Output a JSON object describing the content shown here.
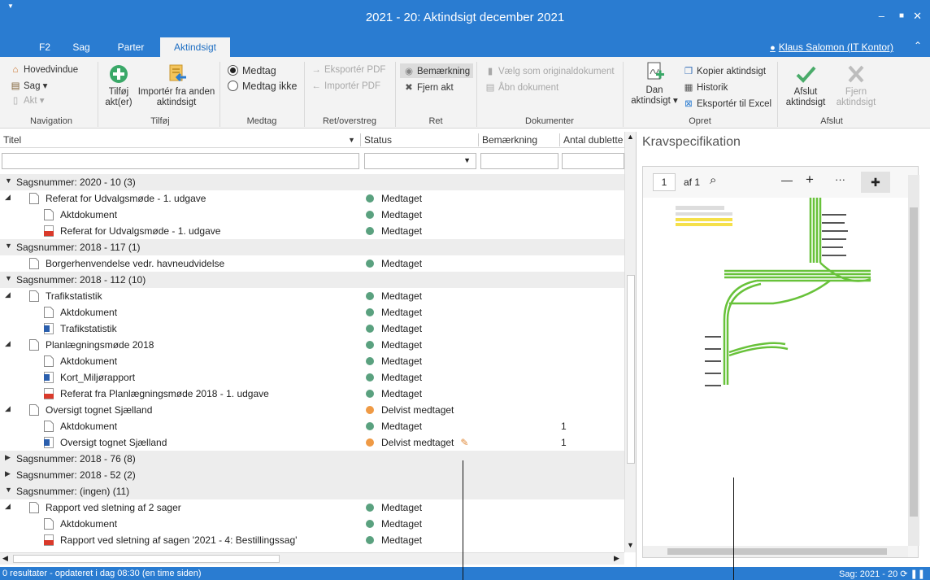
{
  "window": {
    "title": "2021 - 20: Aktindsigt december 2021",
    "minimize": "‒",
    "maximize": "■",
    "close": "✕"
  },
  "tabs": [
    "F2",
    "Sag",
    "Parter",
    "Aktindsigt"
  ],
  "user": "Klaus Salomon (IT Kontor)",
  "ribbon": {
    "navigation": {
      "hovedvindue": "Hovedvindue",
      "sag": "Sag ▾",
      "akt": "Akt ▾",
      "label": "Navigation"
    },
    "tilfoj": {
      "tilfoj_akt": "Tilføj akt(er)",
      "importer": "Importér fra anden aktindsigt",
      "label": "Tilføj"
    },
    "medtag": {
      "medtag": "Medtag",
      "medtag_ikke": "Medtag ikke",
      "label": "Medtag"
    },
    "ret_overstreg": {
      "eksporter_pdf": "Eksportér PDF",
      "importer_pdf": "Importér PDF",
      "label": "Ret/overstreg"
    },
    "ret": {
      "bemaerkning": "Bemærkning",
      "fjern_akt": "Fjern akt",
      "label": "Ret"
    },
    "dokumenter": {
      "vaelg": "Vælg som originaldokument",
      "abn": "Åbn dokument",
      "label": "Dokumenter"
    },
    "opret": {
      "dan": "Dan aktindsigt ▾",
      "kopier": "Kopier aktindsigt",
      "historik": "Historik",
      "excel": "Eksportér til Excel",
      "label": "Opret"
    },
    "afslut": {
      "afslut": "Afslut aktindsigt",
      "fjern": "Fjern aktindsigt",
      "label": "Afslut"
    }
  },
  "columns": {
    "titel": "Titel",
    "status": "Status",
    "bemaerkning": "Bemærkning",
    "antal": "Antal dublette"
  },
  "status_colors": {
    "Medtaget": "#5aa17f",
    "Delvist medtaget": "#ef9a45"
  },
  "rows": [
    {
      "type": "group",
      "open": true,
      "text": "Sagsnummer: 2020 - 10 (3)"
    },
    {
      "type": "item",
      "level": 1,
      "expand": true,
      "icon": "doc",
      "text": "Referat for Udvalgsmøde - 1. udgave",
      "status": "Medtaget",
      "count": ""
    },
    {
      "type": "item",
      "level": 2,
      "icon": "doc",
      "text": "Aktdokument",
      "status": "Medtaget",
      "count": ""
    },
    {
      "type": "item",
      "level": 2,
      "icon": "pdf",
      "text": "Referat for Udvalgsmøde - 1. udgave",
      "status": "Medtaget",
      "count": ""
    },
    {
      "type": "group",
      "open": true,
      "text": "Sagsnummer: 2018 - 117 (1)"
    },
    {
      "type": "item",
      "level": 1,
      "icon": "doc",
      "text": "Borgerhenvendelse vedr. havneudvidelse",
      "status": "Medtaget",
      "count": ""
    },
    {
      "type": "group",
      "open": true,
      "text": "Sagsnummer: 2018 - 112 (10)"
    },
    {
      "type": "item",
      "level": 1,
      "expand": true,
      "icon": "doc",
      "text": "Trafikstatistik",
      "status": "Medtaget",
      "count": ""
    },
    {
      "type": "item",
      "level": 2,
      "icon": "doc",
      "text": "Aktdokument",
      "status": "Medtaget",
      "count": ""
    },
    {
      "type": "item",
      "level": 2,
      "icon": "word",
      "text": "Trafikstatistik",
      "status": "Medtaget",
      "count": ""
    },
    {
      "type": "item",
      "level": 1,
      "expand": true,
      "icon": "doc",
      "text": "Planlægningsmøde 2018",
      "status": "Medtaget",
      "count": ""
    },
    {
      "type": "item",
      "level": 2,
      "icon": "doc",
      "text": "Aktdokument",
      "status": "Medtaget",
      "count": ""
    },
    {
      "type": "item",
      "level": 2,
      "icon": "word",
      "text": "Kort_Miljørapport",
      "status": "Medtaget",
      "count": ""
    },
    {
      "type": "item",
      "level": 2,
      "icon": "pdf",
      "text": "Referat fra Planlægningsmøde 2018 - 1. udgave",
      "status": "Medtaget",
      "count": ""
    },
    {
      "type": "item",
      "level": 1,
      "expand": true,
      "icon": "doc",
      "text": "Oversigt tognet Sjælland",
      "status": "Delvist medtaget",
      "count": ""
    },
    {
      "type": "item",
      "level": 2,
      "icon": "doc",
      "text": "Aktdokument",
      "status": "Medtaget",
      "count": "1"
    },
    {
      "type": "item",
      "level": 2,
      "icon": "word",
      "text": "Oversigt tognet Sjælland",
      "status": "Delvist medtaget",
      "count": "1",
      "pencil": true
    },
    {
      "type": "group",
      "open": false,
      "text": "Sagsnummer: 2018 - 76 (8)"
    },
    {
      "type": "group",
      "open": false,
      "text": "Sagsnummer: 2018 - 52 (2)"
    },
    {
      "type": "group",
      "open": true,
      "text": "Sagsnummer: (ingen) (11)"
    },
    {
      "type": "item",
      "level": 1,
      "expand": true,
      "icon": "doc",
      "text": "Rapport ved sletning af 2 sager",
      "status": "Medtaget",
      "count": ""
    },
    {
      "type": "item",
      "level": 2,
      "icon": "doc",
      "text": "Aktdokument",
      "status": "Medtaget",
      "count": ""
    },
    {
      "type": "item",
      "level": 2,
      "icon": "pdf",
      "text": "Rapport ved sletning af sagen '2021 - 4: Bestillingssag'",
      "status": "Medtaget",
      "count": ""
    }
  ],
  "preview": {
    "title": "Kravspecifikation",
    "page": "1",
    "of": "af 1",
    "zoom_out": "—",
    "zoom_in": "+",
    "more": "···"
  },
  "status": {
    "left": "0 resultater - opdateret i dag 08:30 (en time siden)",
    "right": "Sag: 2021 - 20"
  }
}
